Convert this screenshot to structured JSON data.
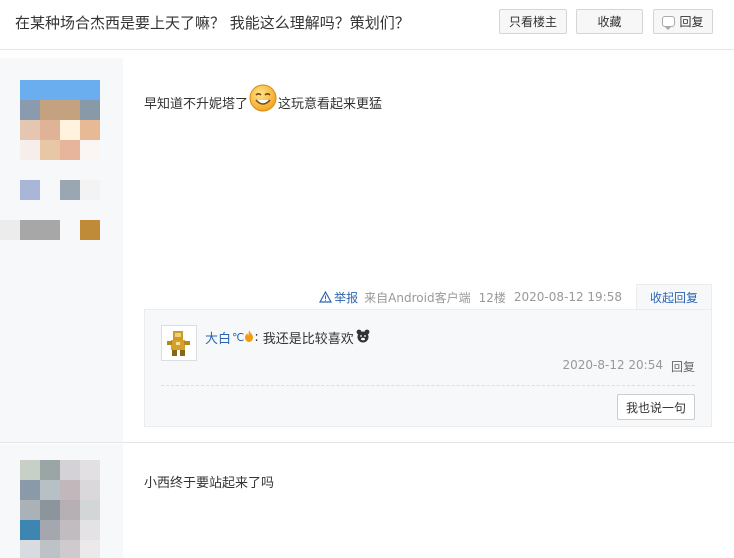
{
  "header": {
    "title": "在某种场合杰西是要上天了嘛？ 我能这么理解吗？策划们？",
    "only_author_label": "只看楼主",
    "favorite_label": "收藏",
    "reply_label": "回复"
  },
  "posts": [
    {
      "content_before": "早知道不升妮塔了",
      "content_after": "这玩意看起来更猛",
      "report_label": "举报",
      "client": "来自Android客户端",
      "floor": "12楼",
      "time": "2020-08-12 19:58",
      "collapse_label": "收起回复",
      "replies": [
        {
          "user": "大白",
          "user_suffix": "℃",
          "colon": ":",
          "text": "我还是比较喜欢",
          "time": "2020-8-12 20:54",
          "reply_label": "回复"
        }
      ],
      "say_label": "我也说一句"
    },
    {
      "content": "小西终于要站起来了吗"
    }
  ],
  "colors": {
    "link": "#2d64b3",
    "muted": "#999999",
    "sidebar_bg": "#f7f8fa",
    "border": "#e4e4e4"
  },
  "icons": {
    "reply": "comment-icon",
    "report": "warning-icon",
    "emoji": "smiley-emoji",
    "emoji2": "bear-emoji",
    "flame": "flame-icon"
  }
}
